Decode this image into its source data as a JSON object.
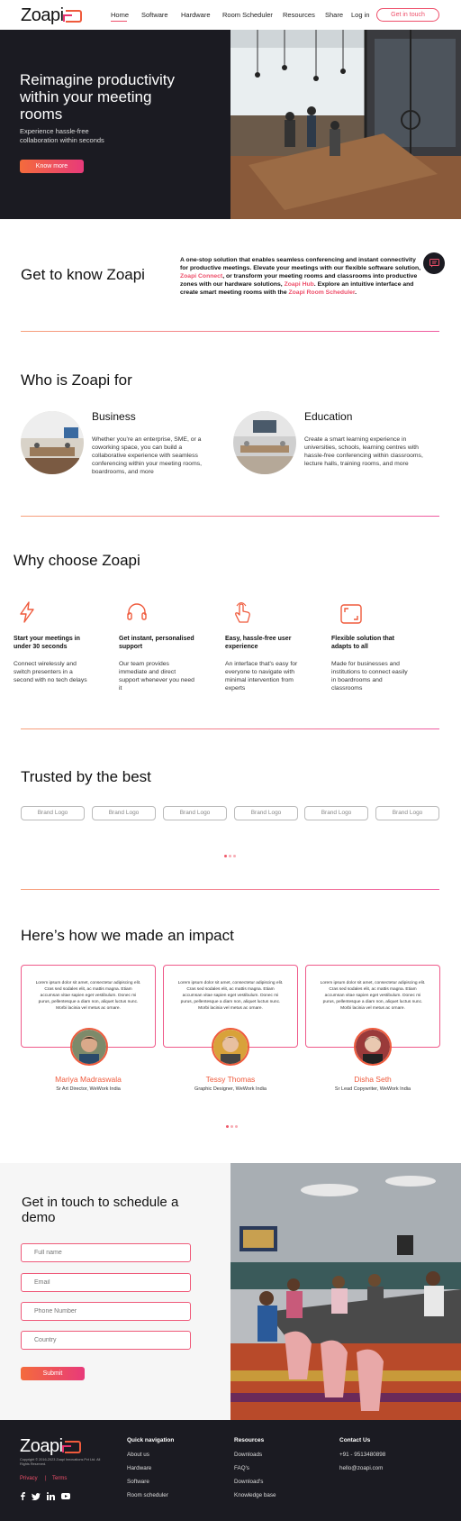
{
  "header": {
    "logo": "Zoapi",
    "nav": [
      "Home",
      "Software",
      "Hardware",
      "Room Scheduler",
      "Resources",
      "Share"
    ],
    "login": "Log in",
    "cta": "Get in touch"
  },
  "hero": {
    "title": "Reimagine productivity within your meeting rooms",
    "subtitle": "Experience hassle-free collaboration within seconds",
    "button": "Know more"
  },
  "know": {
    "title": "Get to know Zoapi",
    "text_a": "A one-stop solution that enables seamless conferencing and instant connectivity for productive meetings. Elevate your meetings with our flexible software solution, ",
    "link_a": "Zoapi Connect",
    "text_b": ", or transform your meeting rooms and classrooms into productive zones with our hardware solutions, ",
    "link_b": "Zoapi Hub",
    "text_c": ". Explore an intuitive interface and create smart meeting rooms with the ",
    "link_c": "Zoapi Room Scheduler",
    "text_d": "."
  },
  "who": {
    "title": "Who is Zoapi for",
    "items": [
      {
        "title": "Business",
        "text": "Whether you're an enterprise, SME, or a coworking space, you can build a collaborative experience with seamless conferencing within your meeting rooms, boardrooms, and more"
      },
      {
        "title": "Education",
        "text": "Create a smart learning experience in universities, schools, learning centres with hassle-free conferencing within classrooms, lecture halls, training rooms, and more"
      }
    ]
  },
  "why": {
    "title": "Why choose Zoapi",
    "items": [
      {
        "icon": "lightning-icon",
        "title": "Start your meetings in under 30 seconds",
        "text": "Connect wirelessly and switch presenters in a second with no tech delays"
      },
      {
        "icon": "headset-icon",
        "title": "Get instant, personalised support",
        "text": "Our team provides immediate and direct support whenever you need it"
      },
      {
        "icon": "hand-pointer-icon",
        "title": "Easy, hassle-free user experience",
        "text": "An interface that's easy for everyone to navigate with minimal intervention from experts"
      },
      {
        "icon": "expand-icon",
        "title": "Flexible solution that adapts to all",
        "text": "Made for businesses and institutions to connect easily in boardrooms and classrooms"
      }
    ]
  },
  "trusted": {
    "title": "Trusted by the best",
    "brands": [
      "Brand Logo",
      "Brand Logo",
      "Brand Logo",
      "Brand Logo",
      "Brand Logo",
      "Brand Logo"
    ]
  },
  "impact": {
    "title": "Here’s how we made an impact",
    "testimonials": [
      {
        "text": "Lorem ipsum dolor sit amet, consectetur adipiscing elit. Cras sed sodales elit, ac mattis magna. Etiam accumsan vitae sapien eget vestibulum. Donec mi purus, pellentesque a diam non, aliquet luctus nunc. Morbi lacinia vel metus ac ornare.",
        "name": "Mariya Madraswala",
        "role": "Sr Art Director, WeWork India"
      },
      {
        "text": "Lorem ipsum dolor sit amet, consectetur adipiscing elit. Cras sed sodales elit, ac mattis magna. Etiam accumsan vitae sapien eget vestibulum. Donec mi purus, pellentesque a diam non, aliquet luctus nunc. Morbi lacinia vel metus ac ornare.",
        "name": "Tessy Thomas",
        "role": "Graphic Designer, WeWork India"
      },
      {
        "text": "Lorem ipsum dolor sit amet, consectetur adipiscing elit. Cras sed sodales elit, ac mattis magna. Etiam accumsan vitae sapien eget vestibulum. Donec mi purus, pellentesque a diam non, aliquet luctus nunc. Morbi lacinia vel metus ac ornare.",
        "name": "Disha Seth",
        "role": "Sr Lead Copywriter, WeWork India"
      }
    ]
  },
  "contact": {
    "title": "Get in touch to schedule a demo",
    "fields": [
      "Full name",
      "Email",
      "Phone Number",
      "Country"
    ],
    "submit": "Submit"
  },
  "footer": {
    "logo": "Zoapi",
    "copyright": "Copyright © 2016-2023 Zoapi Innovations Pvt Ltd. All Rights Reserved.",
    "privacy": "Privacy",
    "terms": "Terms",
    "quick_title": "Quick navigation",
    "quick": [
      "About us",
      "Hardware",
      "Software",
      "Room scheduler"
    ],
    "resources_title": "Resources",
    "resources": [
      "Downloads",
      "FAQ's",
      "Download's",
      "Knowledge base"
    ],
    "contact_title": "Contact Us",
    "phone": "+91 - 9513480898",
    "email": "hello@zoapi.com"
  },
  "colors": {
    "accent": "#ee4f6a",
    "orange": "#f46b3c",
    "dark": "#1b1b22"
  }
}
